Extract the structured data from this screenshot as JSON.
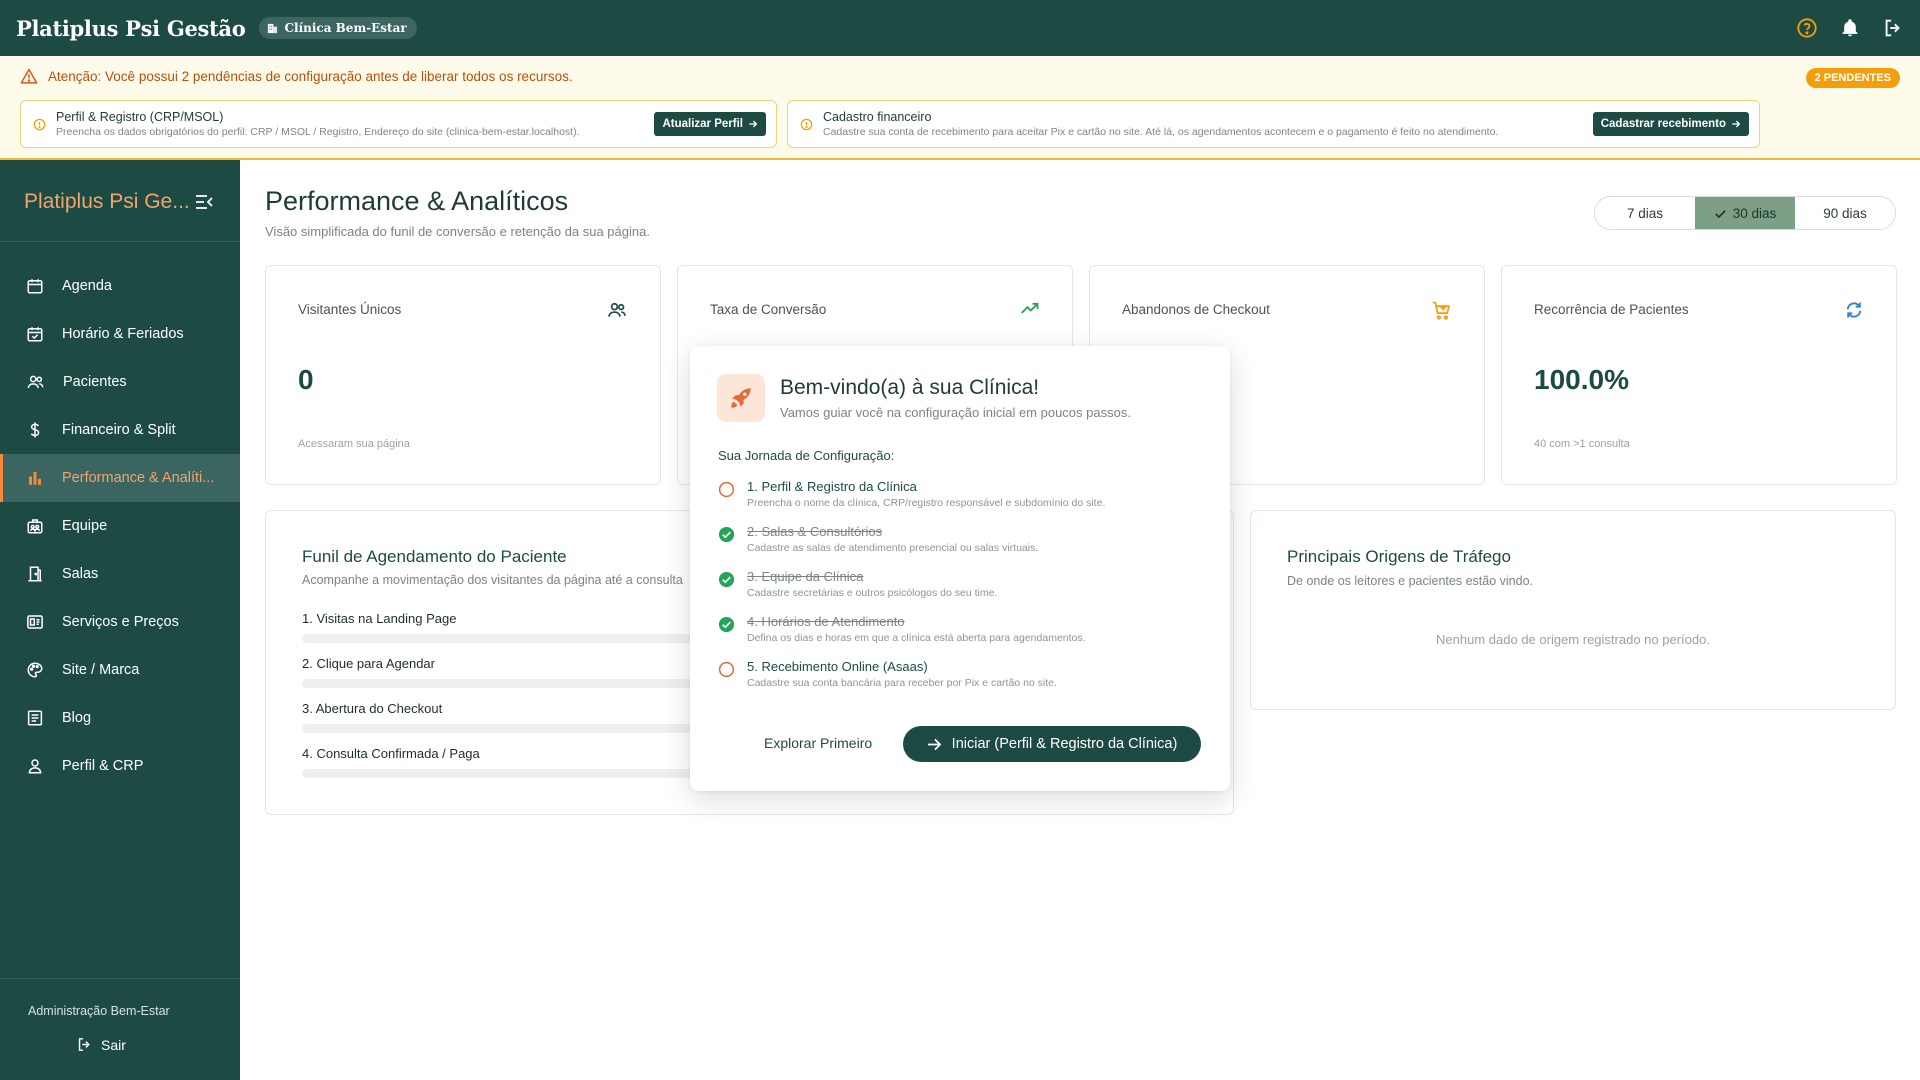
{
  "topbar": {
    "brand": "Platiplus Psi Gestão",
    "clinic": "Clínica Bem-Estar"
  },
  "alert": {
    "message": "Atenção: Você possui 2 pendências de configuração antes de liberar todos os recursos.",
    "badge": "2 PENDENTES",
    "items": [
      {
        "title": "Perfil & Registro (CRP/MSOL)",
        "description": "Preencha os dados obrigatórios do perfil: CRP / MSOL / Registro, Endereço do site (clinica-bem-estar.localhost).",
        "button": "Atualizar Perfil"
      },
      {
        "title": "Cadastro financeiro",
        "description": "Cadastre sua conta de recebimento para aceitar Pix e cartão no site. Até lá, os agendamentos acontecem e o pagamento é feito no atendimento.",
        "button": "Cadastrar recebimento"
      }
    ]
  },
  "sidebar": {
    "brand": "Platiplus Psi Ge...",
    "items": [
      {
        "label": "Agenda",
        "icon": "calendar-icon"
      },
      {
        "label": "Horário & Feriados",
        "icon": "calendar-check-icon"
      },
      {
        "label": "Pacientes",
        "icon": "users-icon"
      },
      {
        "label": "Financeiro & Split",
        "icon": "dollar-icon"
      },
      {
        "label": "Performance & Analíti...",
        "icon": "bar-chart-icon",
        "active": true
      },
      {
        "label": "Equipe",
        "icon": "team-icon"
      },
      {
        "label": "Salas",
        "icon": "door-icon"
      },
      {
        "label": "Serviços e Preços",
        "icon": "price-card-icon"
      },
      {
        "label": "Site / Marca",
        "icon": "palette-icon"
      },
      {
        "label": "Blog",
        "icon": "article-icon"
      },
      {
        "label": "Perfil & CRP",
        "icon": "user-icon"
      }
    ],
    "admin": "Administração Bem-Estar",
    "logout": "Sair"
  },
  "page": {
    "title": "Performance & Analíticos",
    "subtitle": "Visão simplificada do funil de conversão e retenção da sua página.",
    "periods": [
      "7 dias",
      "30 dias",
      "90 dias"
    ],
    "selected_period": "30 dias"
  },
  "stats": [
    {
      "label": "Visitantes Únicos",
      "value": "0",
      "note": "Acessaram sua página",
      "icon": "users-icon"
    },
    {
      "label": "Taxa de Conversão",
      "value": "",
      "note": "",
      "icon": "trending-up-icon"
    },
    {
      "label": "Abandonos de Checkout",
      "value": "",
      "note": "",
      "icon": "cart-plus-icon"
    },
    {
      "label": "Recorrência de Pacientes",
      "value": "100.0%",
      "note": "40 com >1 consulta",
      "icon": "refresh-icon"
    }
  ],
  "funnel": {
    "title": "Funil de Agendamento do Paciente",
    "subtitle": "Acompanhe a movimentação dos visitantes da página até a consulta",
    "steps": [
      {
        "label": "1. Visitas na Landing Page"
      },
      {
        "label": "2. Clique para Agendar"
      },
      {
        "label": "3. Abertura do Checkout"
      },
      {
        "label": "4. Consulta Confirmada / Paga"
      }
    ]
  },
  "traffic": {
    "title": "Principais Origens de Tráfego",
    "subtitle": "De onde os leitores e pacientes estão vindo.",
    "empty": "Nenhum dado de origem registrado no período."
  },
  "modal": {
    "title": "Bem-vindo(a) à sua Clínica!",
    "subtitle": "Vamos guiar você na configuração inicial em poucos passos.",
    "journey_label": "Sua Jornada de Configuração:",
    "steps": [
      {
        "title": "1. Perfil & Registro da Clínica",
        "desc": "Preencha o nome da clínica, CRP/registro responsável e subdomínio do site.",
        "done": false
      },
      {
        "title": "2. Salas & Consultórios",
        "desc": "Cadastre as salas de atendimento presencial ou salas virtuais.",
        "done": true
      },
      {
        "title": "3. Equipe da Clínica",
        "desc": "Cadastre secretárias e outros psicólogos do seu time.",
        "done": true
      },
      {
        "title": "4. Horários de Atendimento",
        "desc": "Defina os dias e horas em que a clínica está aberta para agendamentos.",
        "done": true
      },
      {
        "title": "5. Recebimento Online (Asaas)",
        "desc": "Cadastre sua conta bancária para receber por Pix e cartão no site.",
        "done": false
      }
    ],
    "explore": "Explorar Primeiro",
    "start": "Iniciar (Perfil & Registro da Clínica)"
  },
  "colors": {
    "primary": "#1d4b44",
    "accent": "#f48a3b",
    "warning": "#f59e0b",
    "success": "#22a55a"
  }
}
